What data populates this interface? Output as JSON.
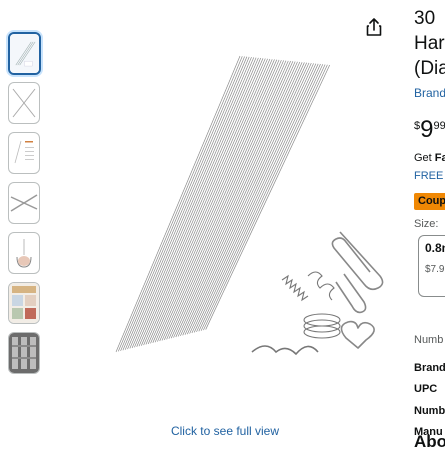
{
  "gallery": {
    "thumbnails": [
      {
        "name": "thumbnail-1",
        "selected": true
      },
      {
        "name": "thumbnail-2",
        "selected": false
      },
      {
        "name": "thumbnail-3",
        "selected": false
      },
      {
        "name": "thumbnail-4",
        "selected": false
      },
      {
        "name": "thumbnail-5",
        "selected": false
      },
      {
        "name": "thumbnail-6",
        "selected": false
      },
      {
        "name": "thumbnail-7",
        "selected": false
      }
    ],
    "see_full_view": "Click to see full view",
    "share_icon": "share-icon"
  },
  "product": {
    "title_line1": "30",
    "title_line2": "Har",
    "title_line3": "(Dia",
    "brand_link": "Brand",
    "price_symbol": "$",
    "price_whole": "9",
    "price_fraction": "99",
    "get_text": "Get ",
    "get_bold": "Fa",
    "free_text": "FREE",
    "coupon_label": "Coup",
    "size_label": "Size: ",
    "size_option": "0.8n",
    "size_option_price": "$7.9",
    "number_label": "Numb",
    "specs": [
      "Brand",
      "UPC",
      "Numb",
      "Manu"
    ],
    "about_heading": "Abo"
  },
  "colors": {
    "link": "#2162a1",
    "coupon": "#f08804",
    "selected_border": "#2162a1"
  }
}
